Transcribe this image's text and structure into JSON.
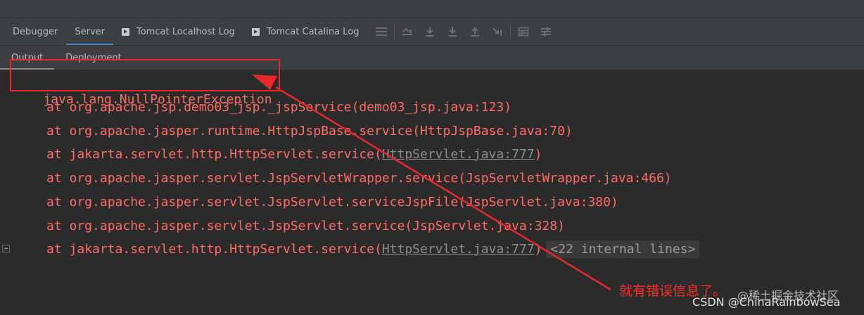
{
  "toolbar": {
    "tabs": [
      {
        "label": "Debugger",
        "active": false
      },
      {
        "label": "Server",
        "active": true
      },
      {
        "label": "Tomcat Localhost Log",
        "active": false
      },
      {
        "label": "Tomcat Catalina Log",
        "active": false
      }
    ],
    "icons": [
      "menu-lines-icon",
      "scroll-to-end-icon",
      "step-over-icon",
      "step-into-icon",
      "step-out-icon",
      "run-to-cursor-icon",
      "evaluate-grid-icon",
      "settings-lines-icon"
    ]
  },
  "subtabs": [
    {
      "label": "Output",
      "active": true
    },
    {
      "label": "Deployment",
      "active": false
    }
  ],
  "console": {
    "exception": "java.lang.NullPointerException",
    "frames": [
      {
        "prefix": "at org.apache.jsp.demo03_jsp._jspService(",
        "link": "",
        "text": "demo03_jsp.java:123",
        "suffix": ")"
      },
      {
        "prefix": "at org.apache.jasper.runtime.HttpJspBase.service(",
        "link": "",
        "text": "HttpJspBase.java:70",
        "suffix": ")"
      },
      {
        "prefix": "at jakarta.servlet.http.HttpServlet.service(",
        "link": "HttpServlet.java:777",
        "text": "",
        "suffix": ")"
      },
      {
        "prefix": "at org.apache.jasper.servlet.JspServletWrapper.service(",
        "link": "",
        "text": "JspServletWrapper.java:466",
        "suffix": ")"
      },
      {
        "prefix": "at org.apache.jasper.servlet.JspServlet.serviceJspFile(",
        "link": "",
        "text": "JspServlet.java:380",
        "suffix": ")"
      },
      {
        "prefix": "at org.apache.jasper.servlet.JspServlet.service(",
        "link": "",
        "text": "JspServlet.java:328",
        "suffix": ")"
      },
      {
        "prefix": "at jakarta.servlet.http.HttpServlet.service(",
        "link": "HttpServlet.java:777",
        "text": "",
        "suffix": ")"
      }
    ],
    "fold_label": "<22 internal lines>"
  },
  "annotation": {
    "note": "就有错误信息了。",
    "color": "#e8282b"
  },
  "watermark": {
    "top": "@稀土掘金技术社区",
    "bottom": "CSDN @ChinaRainbowSea"
  }
}
